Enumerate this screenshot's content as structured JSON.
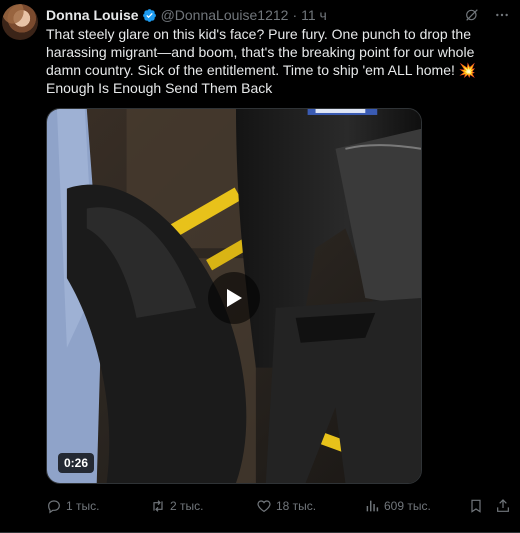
{
  "author": {
    "name": "Donna Louise",
    "handle": "@DonnaLouise1212",
    "separator": "·",
    "time": "11 ч",
    "verified": true
  },
  "tweet": {
    "text": "That steely glare on this kid's face? Pure fury. One punch to drop the harassing migrant—and boom, that's the breaking point for our whole damn country. Sick of the entitlement. Time to ship 'em ALL home! 💥 Enough Is Enough Send Them Back"
  },
  "media": {
    "type": "video",
    "duration": "0:26"
  },
  "actions": {
    "replies": "1 тыс.",
    "retweets": "2 тыс.",
    "likes": "18 тыс.",
    "views": "609 тыс."
  },
  "colors": {
    "background": "#000000",
    "text": "#e7e9ea",
    "muted": "#71767b",
    "verified": "#1d9bf0",
    "border": "#2f3336"
  }
}
